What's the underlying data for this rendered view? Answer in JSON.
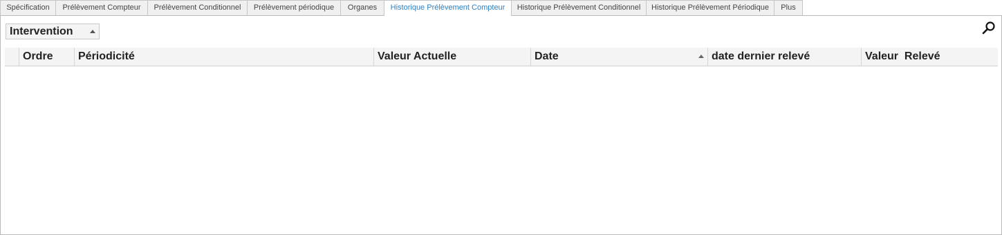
{
  "tabs": [
    {
      "label": "Spécification"
    },
    {
      "label": "Prélèvement Compteur"
    },
    {
      "label": "Prélèvement Conditionnel"
    },
    {
      "label": "Prélèvement périodique"
    },
    {
      "label": "Organes"
    },
    {
      "label": "Historique Prélèvement Compteur"
    },
    {
      "label": "Historique Prélèvement Conditionnel"
    },
    {
      "label": "Historique Prélèvement Périodique"
    },
    {
      "label": "Plus"
    }
  ],
  "active_tab": "Historique Prélèvement Compteur",
  "group_panel": {
    "label": "Intervention",
    "sort": "ascending",
    "icon": "sort-up-icon"
  },
  "search": {
    "icon": "search-icon"
  },
  "grid": {
    "columns": [
      {
        "label": "Ordre"
      },
      {
        "label": "Périodicité"
      },
      {
        "label": "Valeur Actuelle"
      },
      {
        "label": "Date",
        "sort": "ascending"
      },
      {
        "label": "date dernier relevé"
      },
      {
        "label": "Valeur  Relevé"
      }
    ],
    "rows": []
  },
  "colors": {
    "active_tab_text": "#2a7fc5",
    "border": "#b9b9b9",
    "header_bg": "#f4f4f4"
  }
}
